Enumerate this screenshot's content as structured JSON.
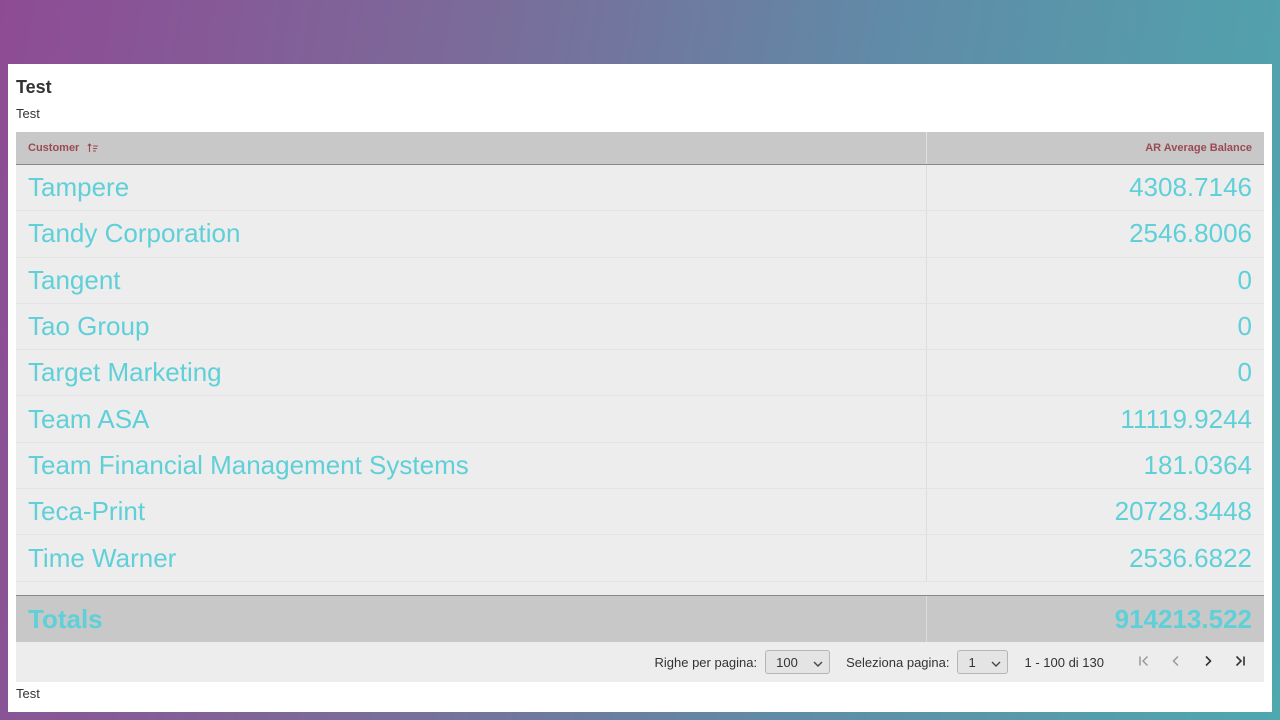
{
  "report": {
    "title": "Test",
    "subtitle": "Test",
    "footer_note": "Test"
  },
  "table": {
    "columns": [
      {
        "label": "Customer",
        "sorted": "ascending"
      },
      {
        "label": "AR Average Balance"
      }
    ],
    "rows": [
      {
        "customer": "Tampere",
        "balance": "4308.7146"
      },
      {
        "customer": "Tandy Corporation",
        "balance": "2546.8006"
      },
      {
        "customer": "Tangent",
        "balance": "0"
      },
      {
        "customer": "Tao Group",
        "balance": "0"
      },
      {
        "customer": "Target Marketing",
        "balance": "0"
      },
      {
        "customer": "Team ASA",
        "balance": "11119.9244"
      },
      {
        "customer": "Team Financial Management Systems",
        "balance": "181.0364"
      },
      {
        "customer": "Teca-Print",
        "balance": "20728.3448"
      },
      {
        "customer": "Time Warner",
        "balance": "2536.6822"
      }
    ],
    "totals": {
      "label": "Totals",
      "value": "914213.522"
    }
  },
  "pager": {
    "rows_per_page_label": "Righe per pagina:",
    "rows_per_page_value": "100",
    "select_page_label": "Seleziona pagina:",
    "page_value": "1",
    "range_text": "1 - 100 di 130"
  },
  "colors": {
    "cell_text": "#5fd0d8",
    "header_text": "#9b4a55",
    "header_bg": "#c8c8c8",
    "body_bg": "#ededed"
  }
}
